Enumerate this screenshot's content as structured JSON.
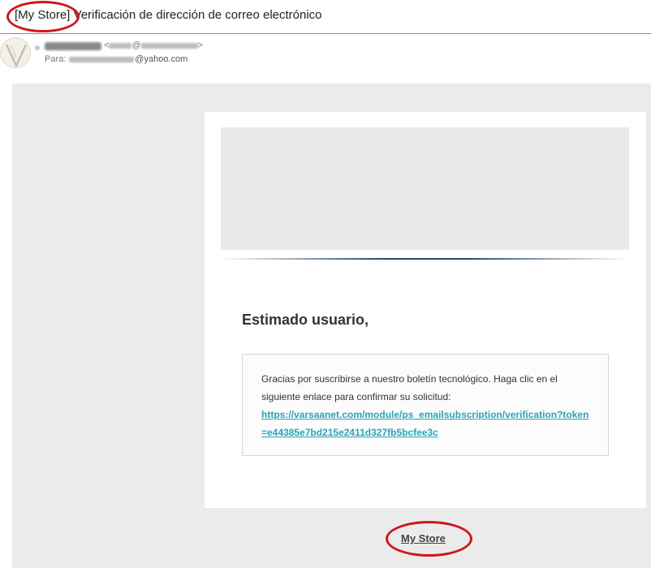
{
  "email": {
    "subject_tag": "[My Store]",
    "subject_text": " Verificación de dirección de correo electrónico",
    "sender_at": "@",
    "sender_close": ">",
    "sender_open": "<",
    "to_label": "Para:",
    "to_domain": "@yahoo.com"
  },
  "content": {
    "greeting": "Estimado usuario,",
    "message": "Gracias por suscribirse a nuestro boletín tecnológico. Haga clic en el siguiente enlace para confirmar su solicitud:",
    "link_url": "https://varsaanet.com/module/ps_emailsubscription/verification?token=e44385e7bd215e2411d327fb5bcfee3c"
  },
  "footer": {
    "store_link": "My Store"
  },
  "colors": {
    "annotation": "#d0161e",
    "link": "#2aa3b5",
    "body_bg": "#ebebeb"
  }
}
